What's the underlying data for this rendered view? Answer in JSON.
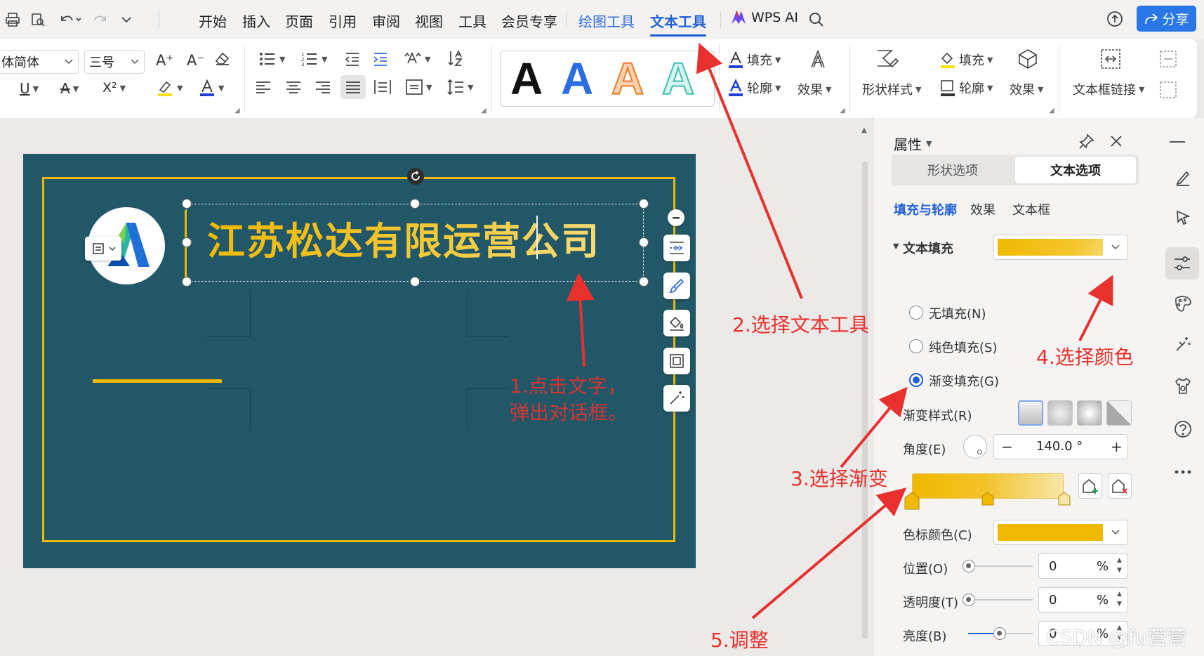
{
  "menu": {
    "tabs": [
      "开始",
      "插入",
      "页面",
      "引用",
      "审阅",
      "视图",
      "工具",
      "会员专享"
    ],
    "draw_tools": "绘图工具",
    "text_tools": "文本工具",
    "wps_ai": "WPS AI",
    "share": "分享"
  },
  "ribbon": {
    "font_name": "体简体",
    "font_size": "三号",
    "font_grow": "A⁺",
    "font_shrink": "A⁻",
    "underline": "U",
    "strike": "A",
    "superscript": "X²",
    "style_letter": "A",
    "fill_label": "填充",
    "outline_label": "轮廓",
    "effect_label": "效果",
    "shape_style_label": "形状样式",
    "shape_fill_label": "填充",
    "shape_outline_label": "轮廓",
    "shape_effect_label": "效果",
    "textbox_link_label": "文本框链接"
  },
  "slide": {
    "title_text": "江苏松达有限运营公司"
  },
  "panel": {
    "title": "属性",
    "tab_shape": "形状选项",
    "tab_text": "文本选项",
    "subtab_fill": "填充与轮廓",
    "subtab_effect": "效果",
    "subtab_textbox": "文本框",
    "section_text_fill": "文本填充",
    "no_fill": "无填充(N)",
    "solid_fill": "纯色填充(S)",
    "gradient_fill": "渐变填充(G)",
    "gradient_style": "渐变样式(R)",
    "angle_label": "角度(E)",
    "angle_value": "140.0  °",
    "stop_color_label": "色标颜色(C)",
    "position_label": "位置(O)",
    "position_value": "0",
    "transparency_label": "透明度(T)",
    "transparency_value": "0",
    "brightness_label": "亮度(B)",
    "brightness_value": "0",
    "percent": "%",
    "minus": "−",
    "plus": "+"
  },
  "annotations": {
    "a1_line1": "1.点击文字，",
    "a1_line2": "弹出对话框。",
    "a2": "2.选择文本工具",
    "a3": "3.选择渐变",
    "a4": "4.选择颜色",
    "a5": "5.调整"
  },
  "watermark": "CSDN @fu营营",
  "colors": {
    "slide_bg": "#215767",
    "gold": "#f0b800",
    "accent_blue": "#1f5fd6",
    "annotation_red": "#e8312e"
  }
}
